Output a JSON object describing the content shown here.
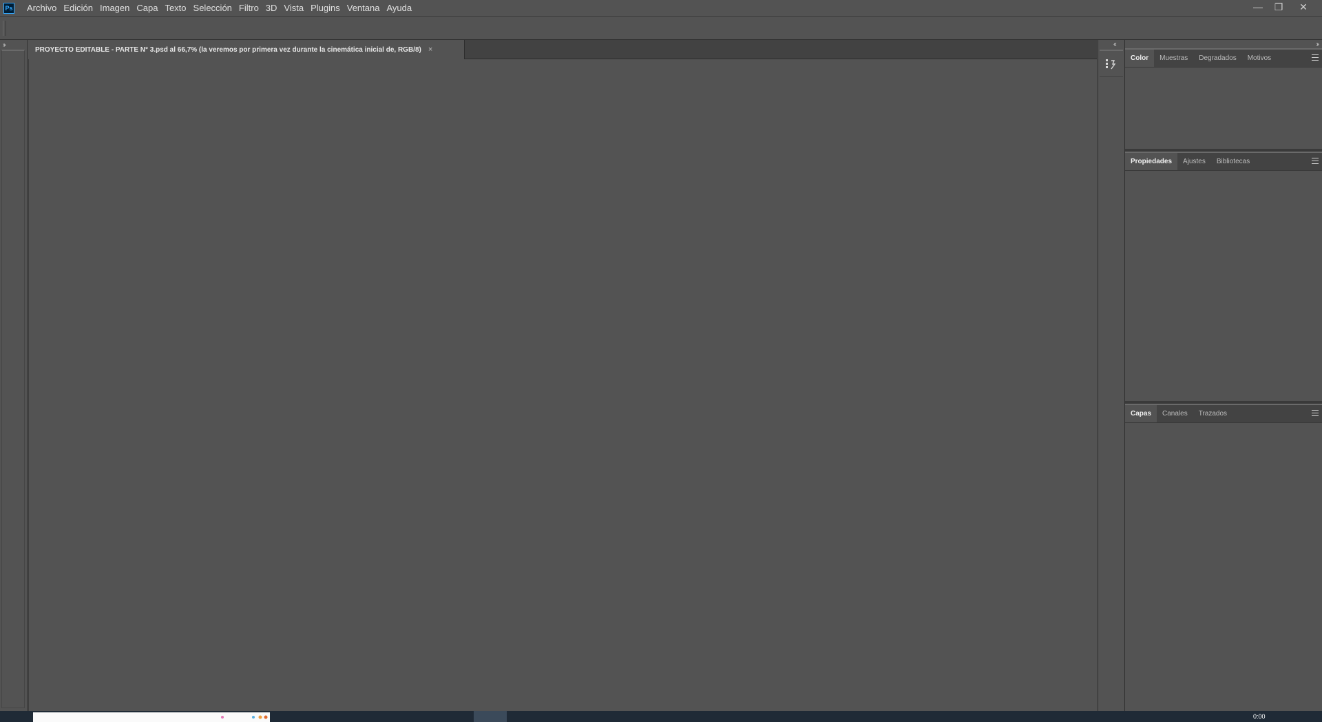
{
  "app": {
    "logo_text": "Ps",
    "menu": [
      "Archivo",
      "Edición",
      "Imagen",
      "Capa",
      "Texto",
      "Selección",
      "Filtro",
      "3D",
      "Vista",
      "Plugins",
      "Ventana",
      "Ayuda"
    ],
    "window_controls": {
      "minimize": "—",
      "restore": "❐",
      "close": "✕"
    }
  },
  "toolbar": {
    "collapse_glyph": "››"
  },
  "document": {
    "tab_title": "PROYECTO EDITABLE - PARTE N° 3.psd al 66,7% (la veremos por primera vez durante la cinemática inicial de, RGB/8)",
    "close_glyph": "×"
  },
  "dock": {
    "collapse_glyph": "‹‹",
    "icons": [
      "history-icon"
    ]
  },
  "panels": {
    "collapse_glyph": "››",
    "color_group": {
      "tabs": [
        "Color",
        "Muestras",
        "Degradados",
        "Motivos"
      ],
      "active": 0
    },
    "properties_group": {
      "tabs": [
        "Propiedades",
        "Ajustes",
        "Bibliotecas"
      ],
      "active": 0
    },
    "layers_group": {
      "tabs": [
        "Capas",
        "Canales",
        "Trazados"
      ],
      "active": 0
    }
  },
  "taskbar": {
    "time": "0:00"
  },
  "colors": {
    "background": "#535353",
    "tab_bar": "#424242",
    "accent": "#31a8ff"
  }
}
